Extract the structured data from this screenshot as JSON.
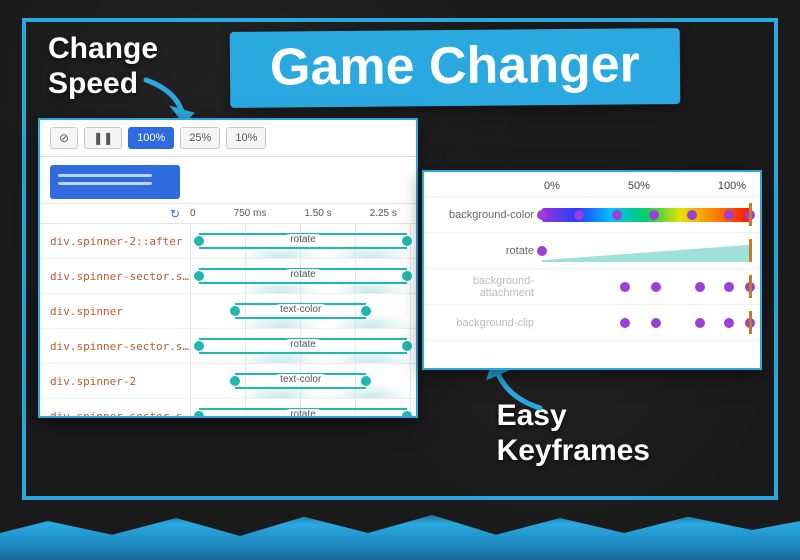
{
  "banner": {
    "title": "Game Changer"
  },
  "callouts": {
    "speed_l1": "Change",
    "speed_l2": "Speed",
    "kf_l1": "Easy",
    "kf_l2": "Keyframes"
  },
  "leftPanel": {
    "toolbar": {
      "clear_glyph": "⊘",
      "pause_glyph": "❚❚",
      "speed_options": [
        "100%",
        "25%",
        "10%"
      ],
      "active_index": 0
    },
    "timeline": {
      "reload_glyph": "↻",
      "ticks": [
        "0",
        "750 ms",
        "1.50 s",
        "2.25 s"
      ]
    },
    "rows": [
      {
        "selector": "div.spinner-2::after",
        "label": "rotate",
        "start": 4,
        "end": 96
      },
      {
        "selector": "div.spinner-sector.spi",
        "label": "rotate",
        "start": 4,
        "end": 96
      },
      {
        "selector": "div.spinner",
        "label": "text-color",
        "start": 20,
        "end": 78
      },
      {
        "selector": "div.spinner-sector.spi",
        "label": "rotate",
        "start": 4,
        "end": 96
      },
      {
        "selector": "div.spinner-2",
        "label": "text-color",
        "start": 20,
        "end": 78
      },
      {
        "selector": "div.spinner-sector.spi",
        "label": "rotate",
        "start": 4,
        "end": 96
      }
    ]
  },
  "rightPanel": {
    "head": [
      "0%",
      "50%",
      "100%"
    ],
    "rows": [
      {
        "prop": "background-color",
        "type": "rainbow",
        "dots": [
          0,
          18,
          36,
          54,
          72,
          90,
          100
        ]
      },
      {
        "prop": "rotate",
        "type": "wedge",
        "dots": [
          0
        ]
      },
      {
        "prop": "background-attachment",
        "type": "faded",
        "dots": [
          40,
          55,
          76,
          90,
          100
        ]
      },
      {
        "prop": "background-clip",
        "type": "faded",
        "dots": [
          40,
          55,
          76,
          90,
          100
        ]
      }
    ]
  }
}
